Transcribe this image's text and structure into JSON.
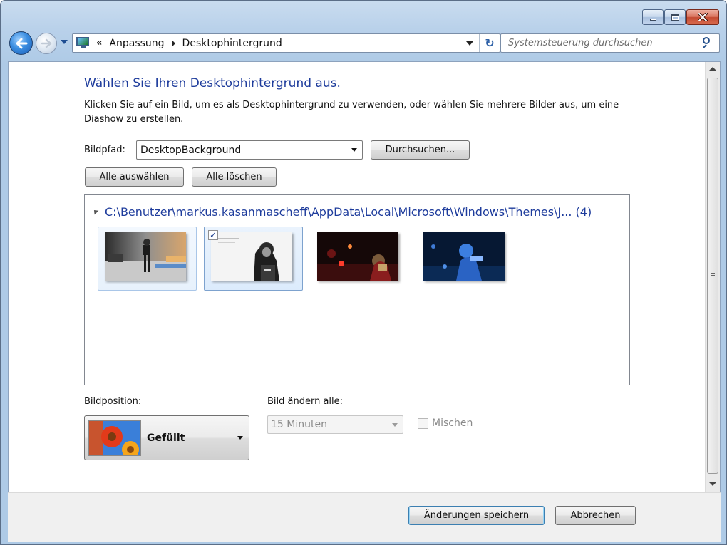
{
  "window": {
    "caption_buttons": [
      "minimize-icon",
      "maximize-icon",
      "close-icon"
    ]
  },
  "nav": {
    "breadcrumb_overflow": "«",
    "breadcrumbs": [
      "Anpassung",
      "Desktophintergrund"
    ],
    "refresh_symbol": "↻",
    "search_placeholder": "Systemsteuerung durchsuchen"
  },
  "page": {
    "title": "Wählen Sie Ihren Desktophintergrund aus.",
    "description": "Klicken Sie auf ein Bild, um es als Desktophintergrund zu verwenden, oder wählen Sie mehrere Bilder aus, um eine Diashow zu erstellen."
  },
  "picture_location": {
    "label": "Bildpfad:",
    "value": "DesktopBackground",
    "browse_label": "Durchsuchen..."
  },
  "selection_buttons": {
    "select_all": "Alle auswählen",
    "clear_all": "Alle löschen"
  },
  "picture_group": {
    "path": "C:\\Benutzer\\markus.kasanmascheff\\AppData\\Local\\Microsoft\\Windows\\Themes\\J... (4)",
    "thumbnails": [
      {
        "name": "wallpaper-1",
        "selected": true,
        "checked": false
      },
      {
        "name": "wallpaper-2",
        "selected": true,
        "checked": true,
        "check_mark": "✓"
      },
      {
        "name": "wallpaper-3",
        "selected": false,
        "checked": false
      },
      {
        "name": "wallpaper-4",
        "selected": false,
        "checked": false
      }
    ]
  },
  "picture_position": {
    "label": "Bildposition:",
    "value": "Gefüllt"
  },
  "change_interval": {
    "label": "Bild ändern alle:",
    "value": "15 Minuten",
    "enabled": false
  },
  "shuffle": {
    "label": "Mischen",
    "checked": false,
    "enabled": false
  },
  "footer": {
    "save_label": "Änderungen speichern",
    "cancel_label": "Abbrechen"
  },
  "colors": {
    "title_blue": "#1e3c9c",
    "frame_blue": "#aecae6",
    "selection_border": "#7da2ce"
  }
}
